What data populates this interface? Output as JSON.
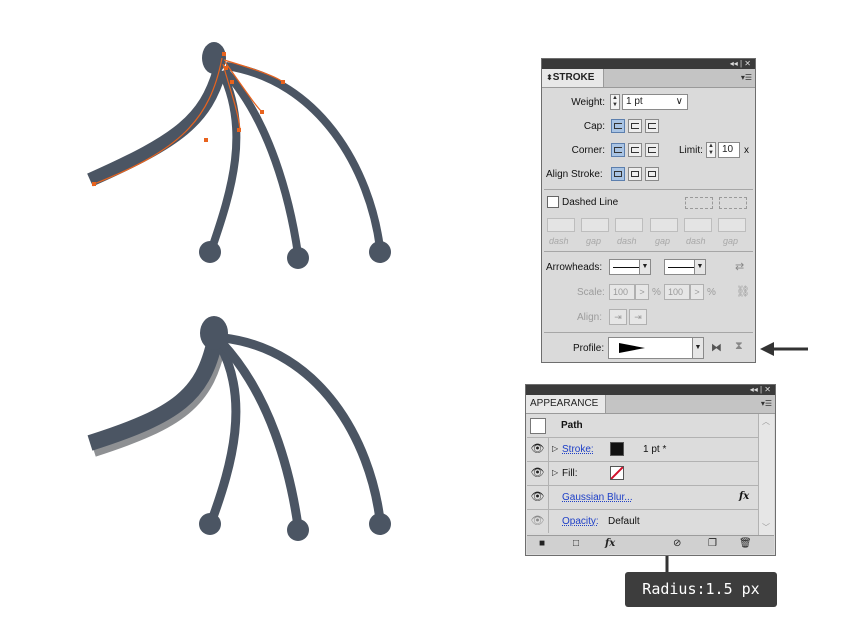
{
  "stroke_panel": {
    "title": "STROKE",
    "weight_label": "Weight:",
    "weight_value": "1 pt",
    "cap_label": "Cap:",
    "corner_label": "Corner:",
    "limit_label": "Limit:",
    "limit_value": "10",
    "limit_unit": "x",
    "align_label": "Align Stroke:",
    "dashed_label": "Dashed Line",
    "dash_labels": [
      "dash",
      "gap",
      "dash",
      "gap",
      "dash",
      "gap"
    ],
    "arrowheads_label": "Arrowheads:",
    "scale_label": "Scale:",
    "scale_start": "100",
    "scale_end": "100",
    "percent": "%",
    "align_arrow_label": "Align:",
    "profile_label": "Profile:"
  },
  "appearance_panel": {
    "title": "APPEARANCE",
    "header": "Path",
    "stroke_label": "Stroke:",
    "stroke_value": "1 pt *",
    "fill_label": "Fill:",
    "effect_label": "Gaussian Blur...",
    "fx_label": "fx",
    "opacity_label": "Opacity:",
    "opacity_value": "Default"
  },
  "tooltip": {
    "text": "Radius:1.5 px"
  },
  "icons": [
    "panel-close-icon",
    "panel-menu-icon",
    "eye-icon",
    "arrow-pointer-icon",
    "fx-icon",
    "trash-icon"
  ],
  "colors": {
    "shape_fill": "#4b5563",
    "anchor_orange": "#e8631e",
    "selection_blue": "#a9c4e4",
    "tooltip_bg": "#3d3d3d"
  }
}
